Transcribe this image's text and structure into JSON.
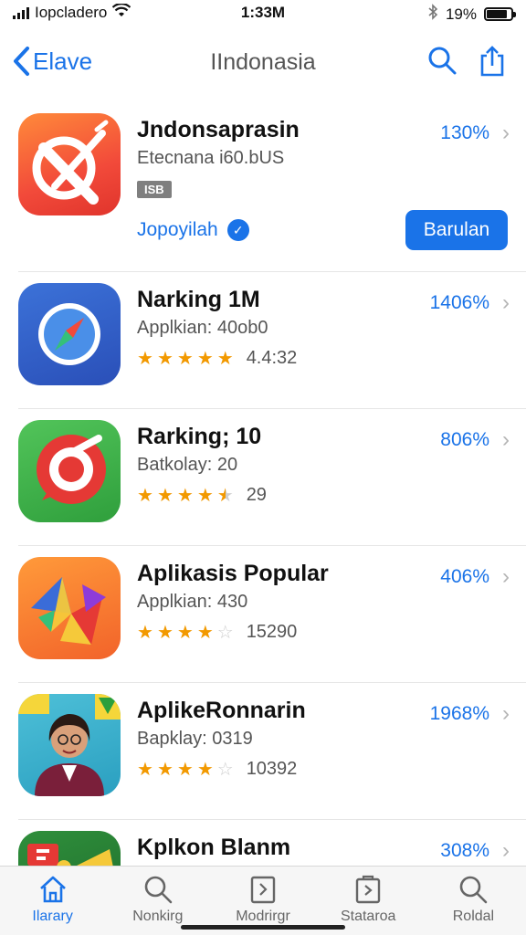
{
  "status": {
    "carrier": "Iopcladero",
    "time": "1:33M",
    "battery": "19%",
    "battery_level": 0.85
  },
  "nav": {
    "back_label": "Elave",
    "title": "IIndonasia"
  },
  "featured": {
    "name": "Jndonsaprasin",
    "subtitle": "Etecnana i60.bUS",
    "badge": "ISB",
    "percent": "130%",
    "link_label": "Jopoyilah",
    "button_label": "Barulan"
  },
  "apps": [
    {
      "name": "Narking 1M",
      "subtitle": "Applkian: 40ob0",
      "rating": 5,
      "count": "4.4:32",
      "percent": "1406%"
    },
    {
      "name": "Rarking; 10",
      "subtitle": "Batkolay: 20",
      "rating": 4.5,
      "count": "29",
      "percent": "806%"
    },
    {
      "name": "Aplikasis Popular",
      "subtitle": "Applkian: 430",
      "rating": 4,
      "count": "15290",
      "percent": "406%"
    },
    {
      "name": "AplikeRonnarin",
      "subtitle": "Bapklay: 0319",
      "rating": 4,
      "count": "10392",
      "percent": "1968%"
    },
    {
      "name": "Kplkon Blanm",
      "percent": "308%"
    }
  ],
  "tabs": [
    {
      "label": "Ilarary",
      "icon": "home-icon",
      "active": true
    },
    {
      "label": "Nonkirg",
      "icon": "search-icon"
    },
    {
      "label": "Modrirgr",
      "icon": "document-icon"
    },
    {
      "label": "Stataroa",
      "icon": "document-icon"
    },
    {
      "label": "Roldal",
      "icon": "search-icon"
    }
  ],
  "colors": {
    "accent": "#1a73e8",
    "star": "#f29900"
  }
}
